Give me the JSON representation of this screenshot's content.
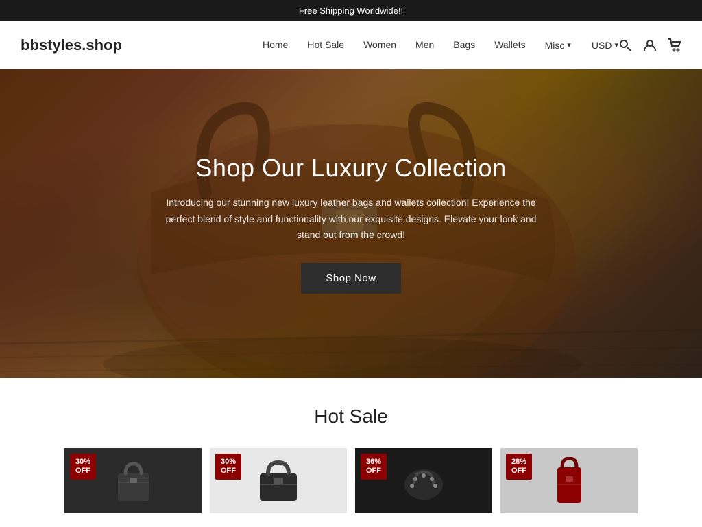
{
  "banner": {
    "text": "Free Shipping Worldwide!!"
  },
  "header": {
    "logo": "bbstyles.shop",
    "nav": [
      {
        "label": "Home",
        "id": "home"
      },
      {
        "label": "Hot Sale",
        "id": "hot-sale"
      },
      {
        "label": "Women",
        "id": "women"
      },
      {
        "label": "Men",
        "id": "men"
      },
      {
        "label": "Bags",
        "id": "bags"
      },
      {
        "label": "Wallets",
        "id": "wallets"
      },
      {
        "label": "Misc",
        "id": "misc"
      }
    ],
    "currency": "USD",
    "icons": {
      "search": "🔍",
      "account": "👤",
      "cart": "🛒"
    }
  },
  "hero": {
    "title": "Shop Our Luxury Collection",
    "subtitle": "Introducing our stunning new luxury leather bags and wallets collection! Experience the perfect blend of style and functionality with our exquisite designs. Elevate your look and stand out from the crowd!",
    "cta_label": "Shop Now"
  },
  "hot_sale": {
    "title": "Hot Sale",
    "products": [
      {
        "badge": "30%\nOFF",
        "badge_side": "right",
        "bg": "dark-bg"
      },
      {
        "badge": "30%\nOFF",
        "badge_side": "right",
        "bg": "light-bg"
      },
      {
        "badge": "36%\nOFF",
        "badge_side": "right",
        "bg": "black-bg"
      },
      {
        "badge": "28%\nOFF",
        "badge_side": "right",
        "bg": "red-bg"
      }
    ]
  }
}
